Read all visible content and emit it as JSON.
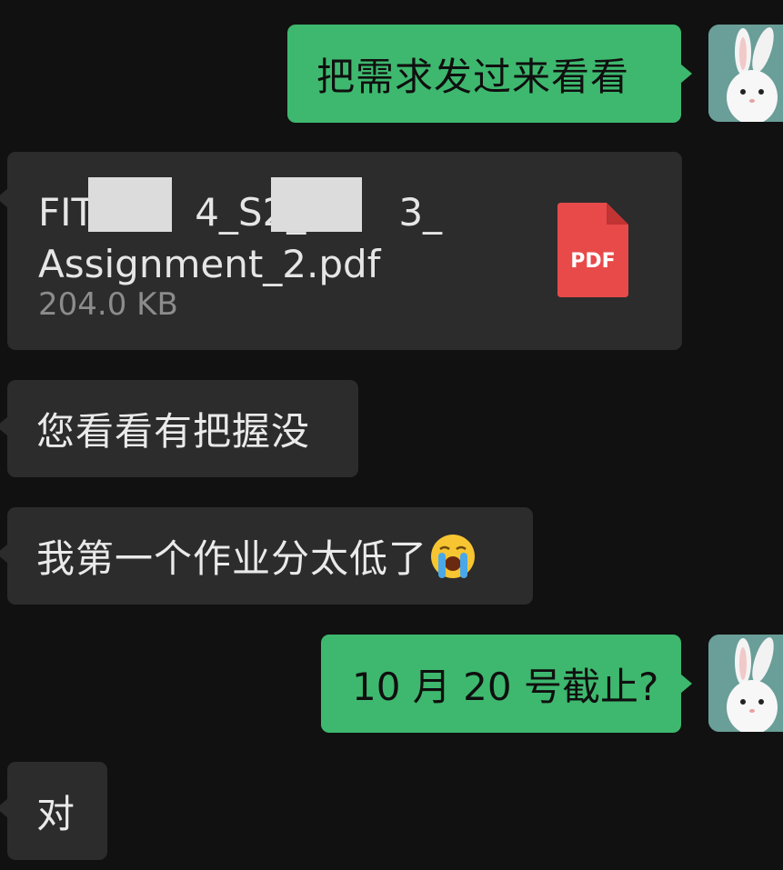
{
  "messages": [
    {
      "id": "m1",
      "direction": "sent",
      "type": "text",
      "text": "把需求发过来看看"
    },
    {
      "id": "m2",
      "direction": "received",
      "type": "file",
      "file_name_line1_a": "FIT",
      "file_name_line1_b": "4_S2_",
      "file_name_line1_c": "3_",
      "file_name_line2": "Assignment_2.pdf",
      "file_size": "204.0 KB",
      "file_type_label": "PDF"
    },
    {
      "id": "m3",
      "direction": "received",
      "type": "text",
      "text": "您看看有把握没"
    },
    {
      "id": "m4",
      "direction": "received",
      "type": "text",
      "text": "我第一个作业分太低了",
      "emoji": "loudly-crying-face"
    },
    {
      "id": "m5",
      "direction": "sent",
      "type": "text",
      "text": "10 月 20 号截止?"
    },
    {
      "id": "m6",
      "direction": "received",
      "type": "text",
      "text": "对"
    }
  ],
  "colors": {
    "background": "#111111",
    "sent_bubble": "#3eb86e",
    "received_bubble": "#2c2c2c",
    "pdf_icon": "#e84a4a",
    "avatar_bg": "#6a9e98"
  },
  "icons": {
    "avatar": "white-rabbit-avatar",
    "file": "pdf-file-icon"
  }
}
